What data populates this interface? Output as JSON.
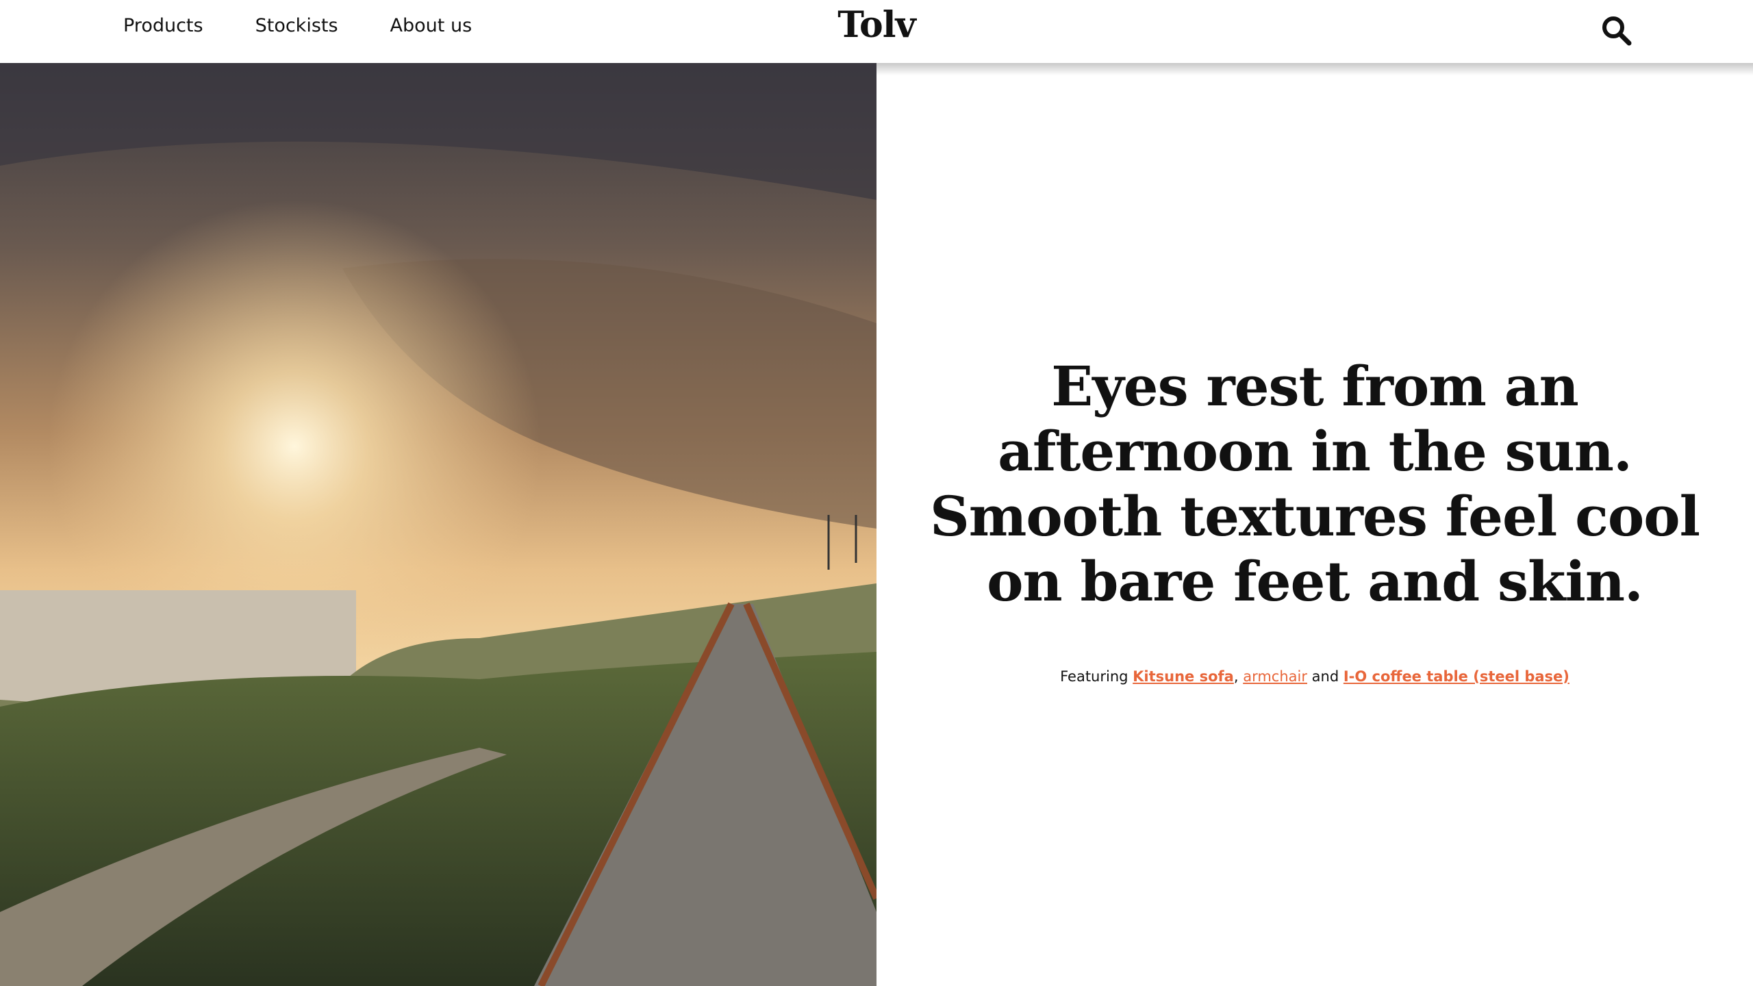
{
  "header": {
    "nav": [
      {
        "label": "Products"
      },
      {
        "label": "Stockists"
      },
      {
        "label": "About us"
      }
    ],
    "logo": "Tolv",
    "search_icon": "search-icon"
  },
  "hero": {
    "image_alt": "sunset over coastal railway tracks",
    "headline_lines": [
      "Eyes rest from an",
      "afternoon in the sun.",
      "Smooth textures feel cool",
      "on bare feet and skin."
    ],
    "featuring": {
      "prefix": "Featuring ",
      "links": [
        {
          "label": "Kitsune sofa"
        },
        {
          "label": "armchair"
        },
        {
          "label": "I-O coffee table (steel base)"
        }
      ],
      "sep1": ", ",
      "sep2": " and "
    }
  },
  "colors": {
    "link": "#e8663a",
    "text": "#111111"
  }
}
